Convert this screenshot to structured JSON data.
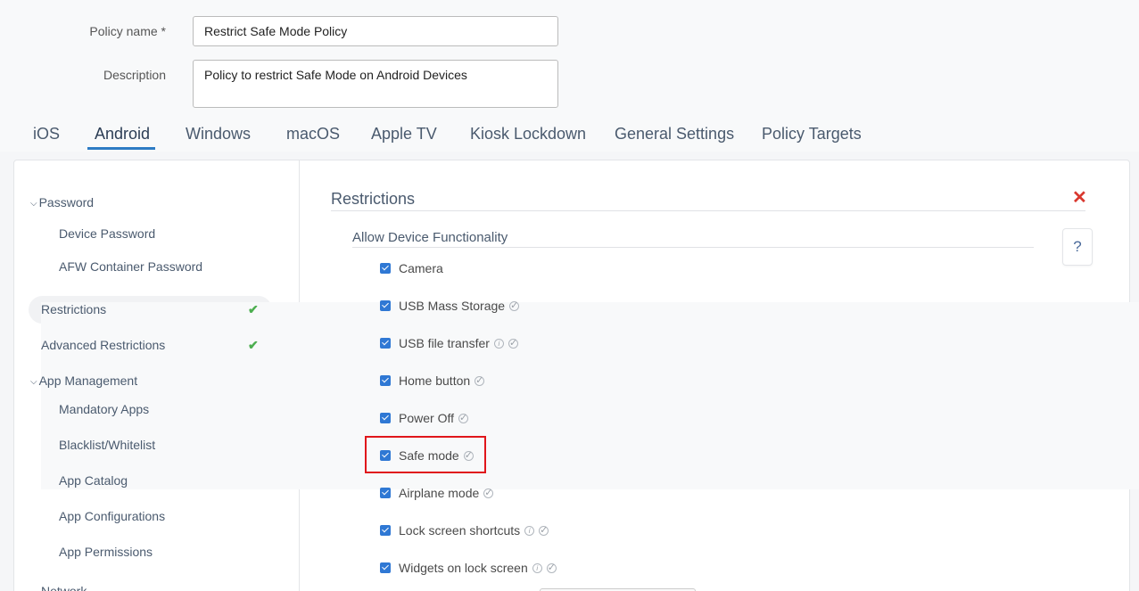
{
  "form": {
    "policy_name_label": "Policy name *",
    "policy_name_value": "Restrict Safe Mode Policy",
    "description_label": "Description",
    "description_value": "Policy to restrict Safe Mode on Android Devices"
  },
  "tabs": [
    {
      "label": "iOS"
    },
    {
      "label": "Android",
      "active": true
    },
    {
      "label": "Windows"
    },
    {
      "label": "macOS"
    },
    {
      "label": "Apple TV"
    },
    {
      "label": "Kiosk Lockdown"
    },
    {
      "label": "General Settings"
    },
    {
      "label": "Policy Targets"
    }
  ],
  "sidebar": {
    "password_group": "Password",
    "device_password": "Device Password",
    "afw_container_password": "AFW Container Password",
    "restrictions": "Restrictions",
    "advanced_restrictions": "Advanced Restrictions",
    "app_management_group": "App Management",
    "mandatory_apps": "Mandatory Apps",
    "blacklist_whitelist": "Blacklist/Whitelist",
    "app_catalog": "App Catalog",
    "app_configurations": "App Configurations",
    "app_permissions": "App Permissions",
    "network_partial": "Network"
  },
  "content": {
    "title": "Restrictions",
    "section": "Allow Device Functionality",
    "help": "?",
    "items": [
      {
        "label": "Camera",
        "checked": true,
        "info": false,
        "verified": false
      },
      {
        "label": "USB Mass Storage",
        "checked": true,
        "info": false,
        "verified": true
      },
      {
        "label": "USB file transfer",
        "checked": true,
        "info": true,
        "verified": true
      },
      {
        "label": "Home button",
        "checked": true,
        "info": false,
        "verified": true
      },
      {
        "label": "Power Off",
        "checked": true,
        "info": false,
        "verified": true
      },
      {
        "label": "Safe mode",
        "checked": true,
        "info": false,
        "verified": true,
        "highlighted": true
      },
      {
        "label": "Airplane mode",
        "checked": true,
        "info": false,
        "verified": true
      },
      {
        "label": "Lock screen shortcuts",
        "checked": true,
        "info": true,
        "verified": true
      },
      {
        "label": "Widgets on lock screen",
        "checked": true,
        "info": true,
        "verified": true
      }
    ]
  },
  "colors": {
    "accent": "#2d7bc4",
    "checkbox": "#2f78d4",
    "success": "#4cae4f",
    "danger": "#d9382f",
    "highlight": "#e0161b"
  },
  "icons": {
    "close": "close-icon",
    "help": "help-icon",
    "info": "info-icon",
    "verified": "verified-icon",
    "status_check": "checkmark-icon",
    "chevron": "chevron-down-icon"
  }
}
